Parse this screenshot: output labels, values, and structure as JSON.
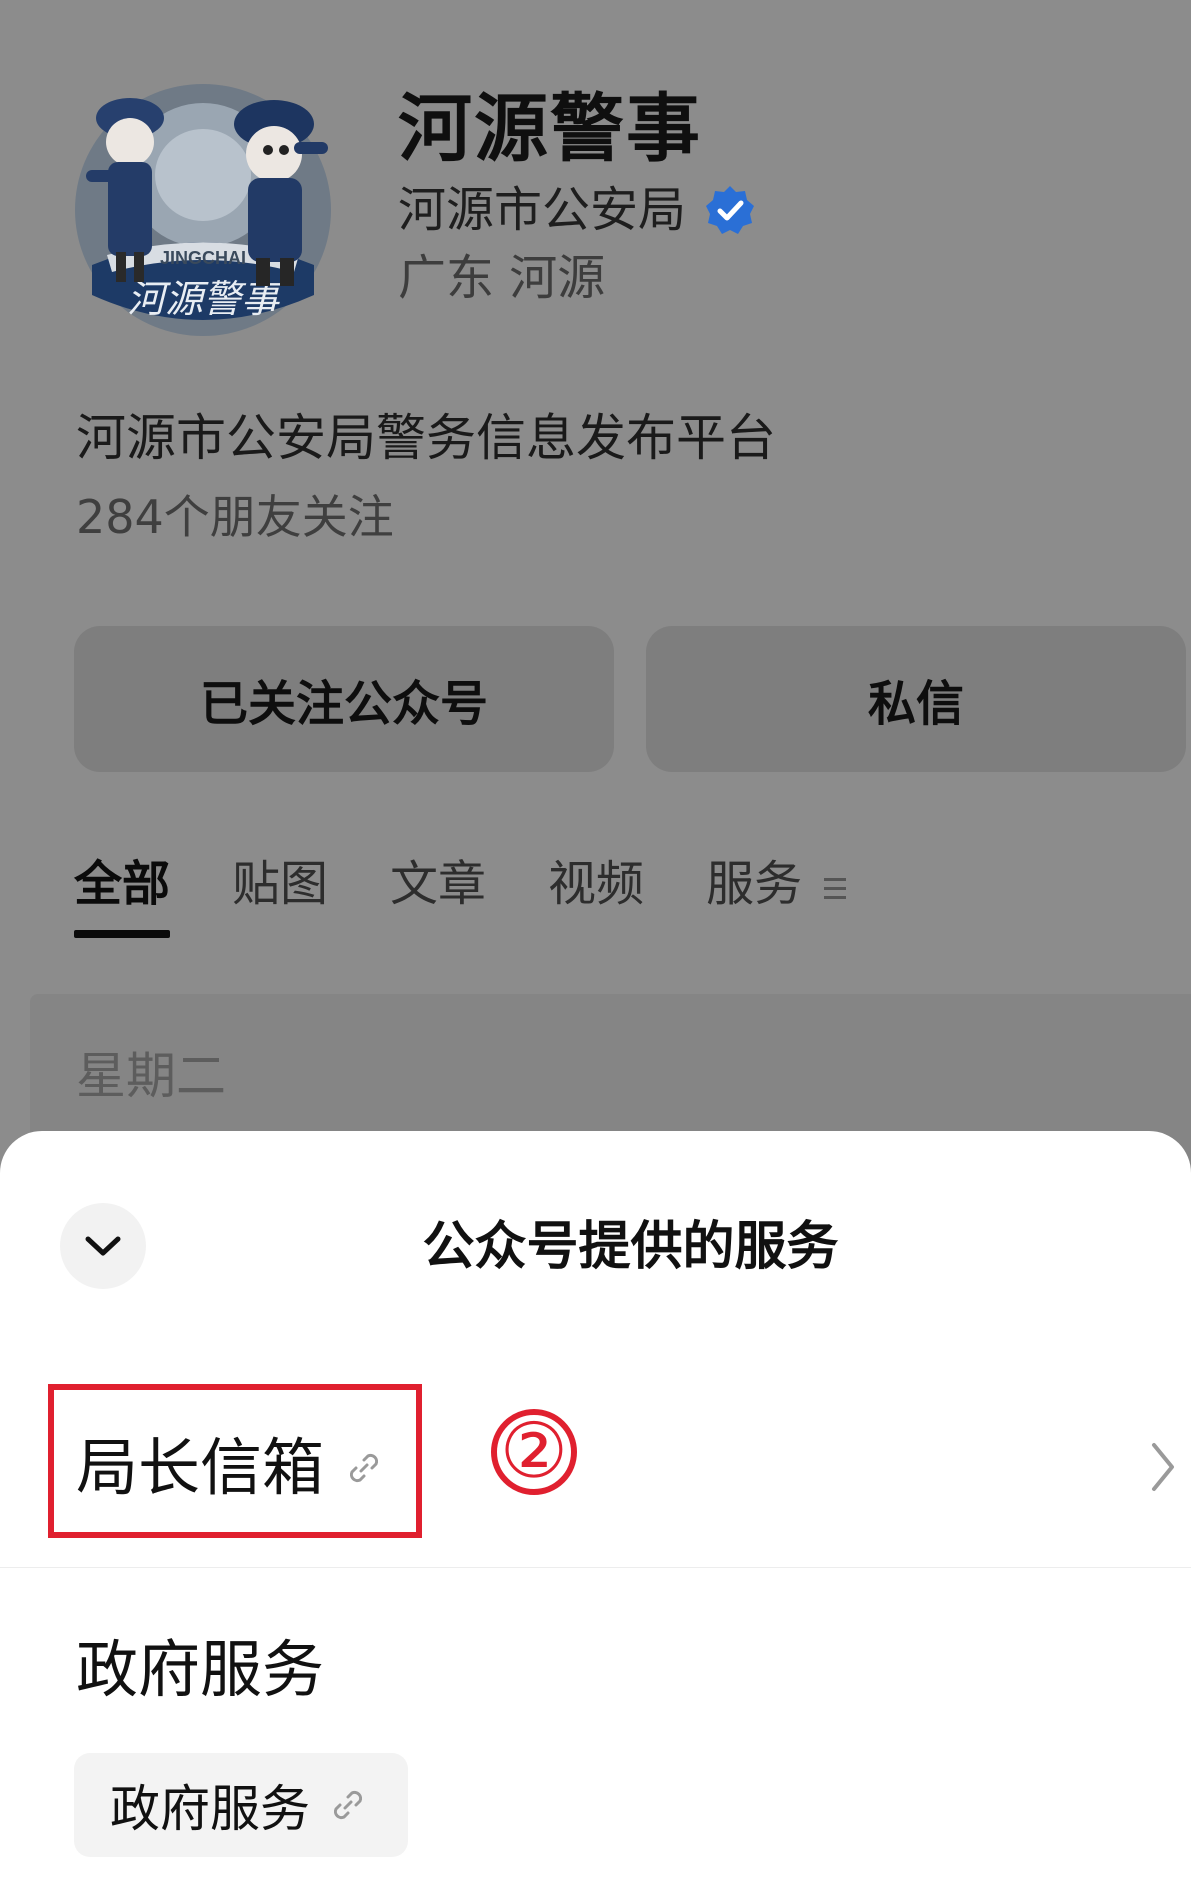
{
  "profile": {
    "name": "河源警事",
    "organization": "河源市公安局",
    "region": "广东 河源",
    "description": "河源市公安局警务信息发布平台",
    "friends_following": "284个朋友关注",
    "avatar_text": "河源警事",
    "avatar_ribbon": "JINGCHAI",
    "follow_button_label": "已关注公众号",
    "message_button_label": "私信"
  },
  "tabs": [
    {
      "label": "全部",
      "active": true
    },
    {
      "label": "贴图",
      "active": false
    },
    {
      "label": "文章",
      "active": false
    },
    {
      "label": "视频",
      "active": false
    },
    {
      "label": "服务",
      "active": false
    }
  ],
  "feed": {
    "date_label": "星期二"
  },
  "sheet": {
    "title": "公众号提供的服务",
    "close_icon": "chevron-down-icon",
    "services": [
      {
        "label": "局长信箱",
        "icon": "link-icon",
        "step_marker": "②"
      }
    ],
    "group": {
      "title": "政府服务",
      "chips": [
        {
          "label": "政府服务",
          "icon": "link-icon"
        }
      ]
    }
  },
  "colors": {
    "overlay_gray": "#8c8c8c",
    "highlight_red": "#e0202f",
    "verified_blue": "#2a6fd6",
    "sheet_bg": "#ffffff"
  }
}
